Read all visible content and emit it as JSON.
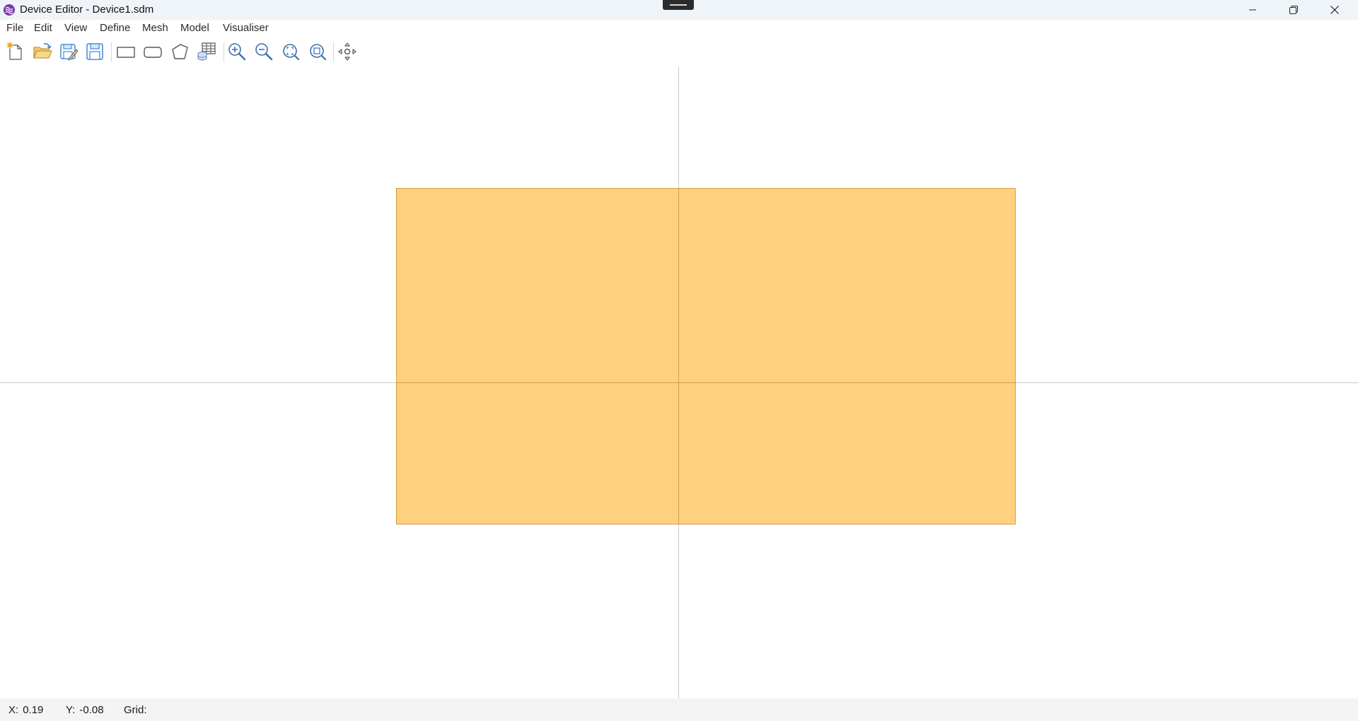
{
  "window": {
    "title": "Device Editor - Device1.sdm"
  },
  "menu": {
    "items": [
      "File",
      "Edit",
      "View",
      "Define",
      "Mesh",
      "Model",
      "Visualiser"
    ]
  },
  "toolbar": {
    "tools": [
      "new-file-icon",
      "open-folder-icon",
      "save-as-icon",
      "save-icon",
      "rectangle-icon",
      "rounded-rectangle-icon",
      "polygon-icon",
      "material-table-icon",
      "zoom-in-icon",
      "zoom-out-icon",
      "zoom-fit-icon",
      "zoom-extents-icon",
      "pan-view-icon"
    ]
  },
  "canvas": {
    "shape_fill": "#ffd17f",
    "shape_stroke": "#d99a3a",
    "axis_color": "#c9c9c9"
  },
  "status": {
    "x_label": "X:",
    "x_value": "0.19",
    "y_label": "Y:",
    "y_value": "-0.08",
    "grid_label": "Grid:",
    "grid_value": ""
  }
}
